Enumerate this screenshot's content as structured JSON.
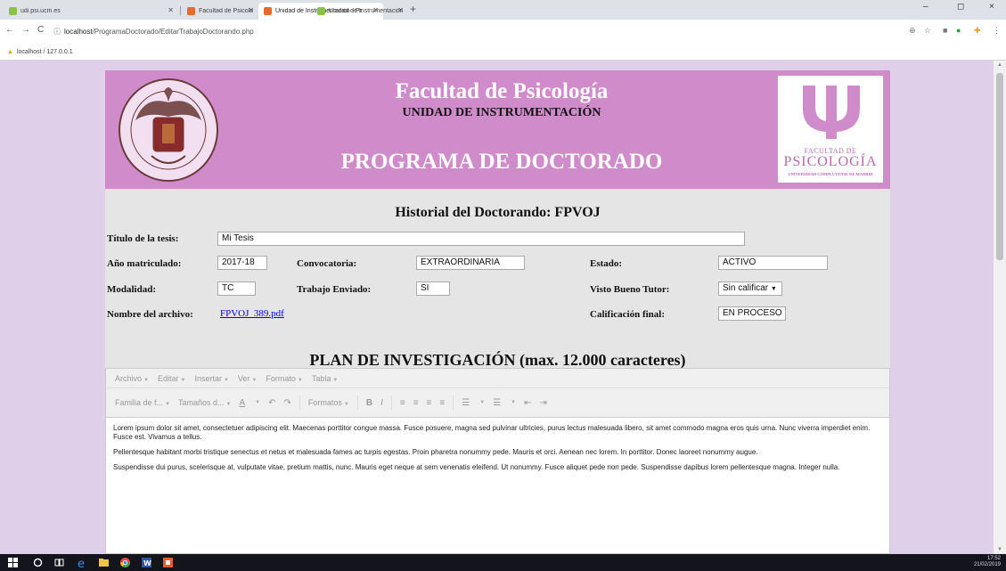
{
  "browser": {
    "tabs": [
      {
        "title": "udi.psi.ucm.es",
        "active": false
      },
      {
        "title": "Facultad de Psicología. Intranet",
        "active": false
      },
      {
        "title": "Unidad de Instrumentación - Pr",
        "active": true
      },
      {
        "title": "Unidad de Instrumentación - Pr",
        "active": false
      }
    ],
    "new_tab": "+",
    "window_controls": [
      "–",
      "◻",
      "×"
    ],
    "url_host": "localhost",
    "url_path": "/ProgramaDoctorado/EditarTrabajoDoctorando.php",
    "bookmark": "localhost / 127.0.0.1"
  },
  "header": {
    "title": "Facultad de Psicología",
    "subtitle": "UNIDAD DE INSTRUMENTACIÓN",
    "program": "PROGRAMA DE DOCTORADO",
    "logo_line1": "FACULTAD DE",
    "logo_line2": "PSICOLOGÍA",
    "logo_line3": "UNIVERSIDAD COMPLUTENSE DE MADRID"
  },
  "form": {
    "heading": "Historial del Doctorando: FPVOJ",
    "titulo_label": "Título de la tesis:",
    "titulo_value": "Mi Tesis",
    "anio_label": "Año matriculado:",
    "anio_value": "2017-18",
    "convocatoria_label": "Convocatoria:",
    "convocatoria_value": "EXTRAORDINARIA",
    "estado_label": "Estado:",
    "estado_value": "ACTIVO",
    "modalidad_label": "Modalidad:",
    "modalidad_value": "TC",
    "enviado_label": "Trabajo Enviado:",
    "enviado_value": "SI",
    "visto_label": "Visto Bueno Tutor:",
    "visto_value": "Sin calificar",
    "archivo_label": "Nombre del archivo:",
    "archivo_value": "FPVOJ_389.pdf",
    "calificacion_label": "Calificación final:",
    "calificacion_value": "EN PROCESO"
  },
  "plan": {
    "heading": "PLAN DE INVESTIGACIÓN (max. 12.000 caracteres)"
  },
  "editor": {
    "menu": [
      "Archivo",
      "Editar",
      "Insertar",
      "Ver",
      "Formato",
      "Tabla"
    ],
    "font_family": "Familia de f...",
    "font_size": "Tamaños d...",
    "formats": "Formatos",
    "paragraphs": [
      "Lorem ipsum dolor sit amet, consectetuer adipiscing elit. Maecenas porttitor congue massa. Fusce posuere, magna sed pulvinar ultricies, purus lectus malesuada libero, sit amet commodo magna eros quis urna. Nunc viverra imperdiet enim. Fusce est. Vivamus a tellus.",
      "Pellentesque habitant morbi tristique senectus et netus et malesuada fames ac turpis egestas. Proin pharetra nonummy pede. Mauris et orci. Aenean nec lorem. In porttitor. Donec laoreet nonummy augue.",
      "Suspendisse dui purus, scelerisque at, vulputate vitae, pretium mattis, nunc. Mauris eget neque at sem venenatis eleifend. Ut nonummy. Fusce aliquet pede non pede. Suspendisse dapibus lorem pellentesque magna. Integer nulla."
    ]
  },
  "taskbar": {
    "time": "17:52",
    "date": "21/02/2019"
  },
  "colors": {
    "banner": "#cf8bca",
    "page_bg": "#dfcfe8",
    "content_bg": "#e5e5e5"
  }
}
